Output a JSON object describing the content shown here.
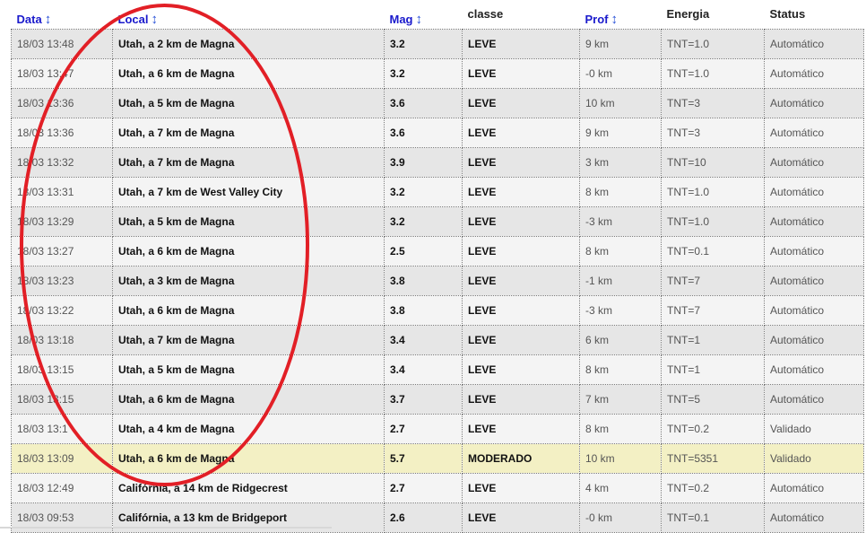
{
  "headers": {
    "data": "Data",
    "local": "Local",
    "mag": "Mag",
    "classe": "classe",
    "prof": "Prof",
    "energia": "Energia",
    "status": "Status"
  },
  "sort_icon": "sort-arrows-icon",
  "highlight_color": "#e21f26",
  "rows": [
    {
      "data": "18/03 13:48",
      "local": "Utah, a 2 km de Magna",
      "mag": "3.2",
      "classe": "LEVE",
      "prof": "9 km",
      "energia": "TNT=1.0",
      "status": "Automático"
    },
    {
      "data": "18/03 13:47",
      "local": "Utah, a 6 km de Magna",
      "mag": "3.2",
      "classe": "LEVE",
      "prof": "-0 km",
      "energia": "TNT=1.0",
      "status": "Automático"
    },
    {
      "data": "18/03 13:36",
      "local": "Utah, a 5 km de Magna",
      "mag": "3.6",
      "classe": "LEVE",
      "prof": "10 km",
      "energia": "TNT=3",
      "status": "Automático"
    },
    {
      "data": "18/03 13:36",
      "local": "Utah, a 7 km de Magna",
      "mag": "3.6",
      "classe": "LEVE",
      "prof": "9 km",
      "energia": "TNT=3",
      "status": "Automático"
    },
    {
      "data": "18/03 13:32",
      "local": "Utah, a 7 km de Magna",
      "mag": "3.9",
      "classe": "LEVE",
      "prof": "3 km",
      "energia": "TNT=10",
      "status": "Automático"
    },
    {
      "data": "18/03 13:31",
      "local": "Utah, a 7 km de West Valley City",
      "mag": "3.2",
      "classe": "LEVE",
      "prof": "8 km",
      "energia": "TNT=1.0",
      "status": "Automático"
    },
    {
      "data": "18/03 13:29",
      "local": "Utah, a 5 km de Magna",
      "mag": "3.2",
      "classe": "LEVE",
      "prof": "-3 km",
      "energia": "TNT=1.0",
      "status": "Automático"
    },
    {
      "data": "18/03 13:27",
      "local": "Utah, a 6 km de Magna",
      "mag": "2.5",
      "classe": "LEVE",
      "prof": "8 km",
      "energia": "TNT=0.1",
      "status": "Automático"
    },
    {
      "data": "18/03 13:23",
      "local": "Utah, a 3 km de Magna",
      "mag": "3.8",
      "classe": "LEVE",
      "prof": "-1 km",
      "energia": "TNT=7",
      "status": "Automático"
    },
    {
      "data": "18/03 13:22",
      "local": "Utah, a 6 km de Magna",
      "mag": "3.8",
      "classe": "LEVE",
      "prof": "-3 km",
      "energia": "TNT=7",
      "status": "Automático"
    },
    {
      "data": "18/03 13:18",
      "local": "Utah, a 7 km de Magna",
      "mag": "3.4",
      "classe": "LEVE",
      "prof": "6 km",
      "energia": "TNT=1",
      "status": "Automático"
    },
    {
      "data": "18/03 13:15",
      "local": "Utah, a 5 km de Magna",
      "mag": "3.4",
      "classe": "LEVE",
      "prof": "8 km",
      "energia": "TNT=1",
      "status": "Automático"
    },
    {
      "data": "18/03 13:15",
      "local": "Utah, a 6 km de Magna",
      "mag": "3.7",
      "classe": "LEVE",
      "prof": "7 km",
      "energia": "TNT=5",
      "status": "Automático"
    },
    {
      "data": "18/03 13:1",
      "local": "Utah, a 4 km de Magna",
      "mag": "2.7",
      "classe": "LEVE",
      "prof": "8 km",
      "energia": "TNT=0.2",
      "status": "Validado"
    },
    {
      "data": "18/03 13:09",
      "local": "Utah, a 6 km de Magna",
      "mag": "5.7",
      "classe": "MODERADO",
      "prof": "10 km",
      "energia": "TNT=5351",
      "status": "Validado"
    },
    {
      "data": "18/03 12:49",
      "local": "Califórnia, a 14 km de Ridgecrest",
      "mag": "2.7",
      "classe": "LEVE",
      "prof": "4 km",
      "energia": "TNT=0.2",
      "status": "Automático"
    },
    {
      "data": "18/03 09:53",
      "local": "Califórnia, a 13 km de Bridgeport",
      "mag": "2.6",
      "classe": "LEVE",
      "prof": "-0 km",
      "energia": "TNT=0.1",
      "status": "Automático"
    }
  ],
  "highlighted_row_index": 14
}
